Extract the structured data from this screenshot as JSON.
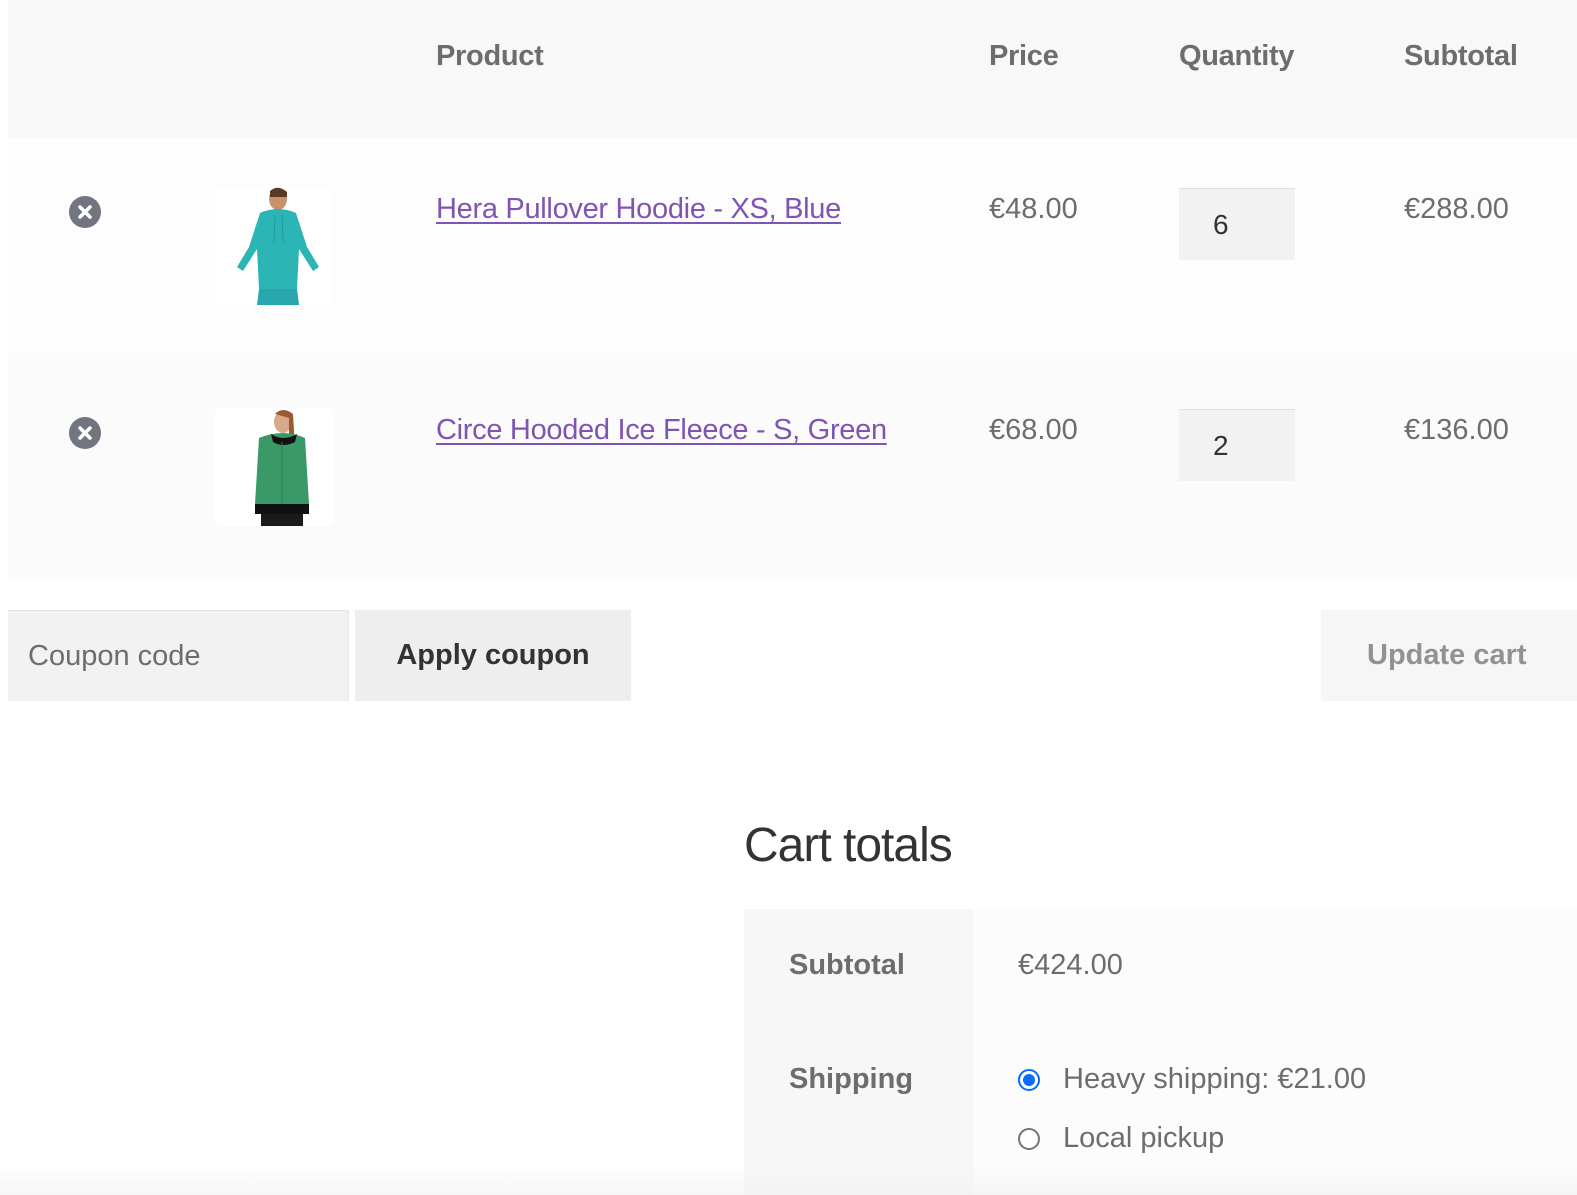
{
  "cart": {
    "headers": {
      "remove": "",
      "thumbnail": "",
      "product": "Product",
      "price": "Price",
      "quantity": "Quantity",
      "subtotal": "Subtotal"
    },
    "items": [
      {
        "name": "Hera Pullover Hoodie - XS, Blue",
        "price": "€48.00",
        "quantity": "6",
        "subtotal": "€288.00",
        "image_icon": "teal-hoodie-product-photo",
        "image_color": "#2bb5b5"
      },
      {
        "name": "Circe Hooded Ice Fleece - S, Green",
        "price": "€68.00",
        "quantity": "2",
        "subtotal": "€136.00",
        "image_icon": "green-fleece-product-photo",
        "image_color": "#3a9a67"
      }
    ],
    "remove_icon": "remove-circle-x-icon"
  },
  "actions": {
    "coupon_placeholder": "Coupon code",
    "apply_coupon_label": "Apply coupon",
    "update_cart_label": "Update cart"
  },
  "totals": {
    "title": "Cart totals",
    "subtotal_label": "Subtotal",
    "subtotal_value": "€424.00",
    "shipping_label": "Shipping",
    "shipping_options": [
      {
        "label": "Heavy shipping: €21.00",
        "selected": true
      },
      {
        "label": "Local pickup",
        "selected": false
      }
    ]
  },
  "colors": {
    "link": "#7f54b3",
    "radio_accent": "#0b6df7",
    "remove_icon": "#717580"
  }
}
